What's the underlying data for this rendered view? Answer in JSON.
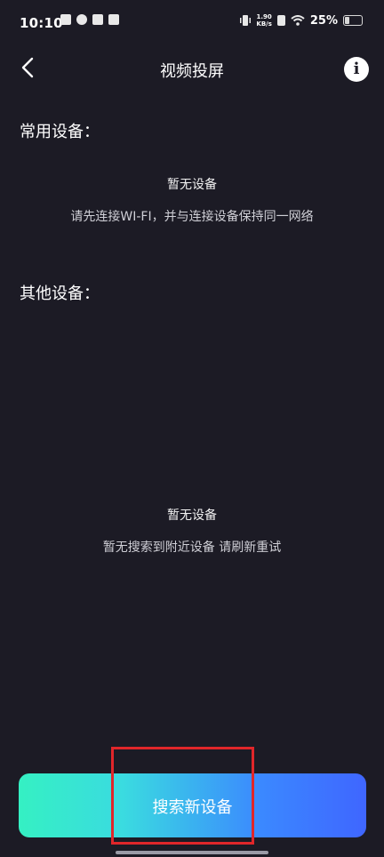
{
  "status_bar": {
    "time": "10:10",
    "net_speed_value": "1.90",
    "net_speed_unit": "KB/s",
    "battery": "25%"
  },
  "header": {
    "title": "视频投屏",
    "back_icon": "chevron-left-icon",
    "info_icon": "info-icon",
    "info_glyph": "i"
  },
  "common_devices": {
    "title": "常用设备：",
    "empty_title": "暂无设备",
    "empty_desc": "请先连接WI-FI，并与连接设备保持同一网络"
  },
  "other_devices": {
    "title": "其他设备：",
    "empty_title": "暂无设备",
    "empty_desc": "暂无搜索到附近设备 请刷新重试"
  },
  "search_button": {
    "label": "搜索新设备"
  },
  "colors": {
    "background": "#1c1b25",
    "button_gradient_start": "#35f0c3",
    "button_gradient_end": "#3f66ff",
    "highlight": "#e0262a"
  }
}
